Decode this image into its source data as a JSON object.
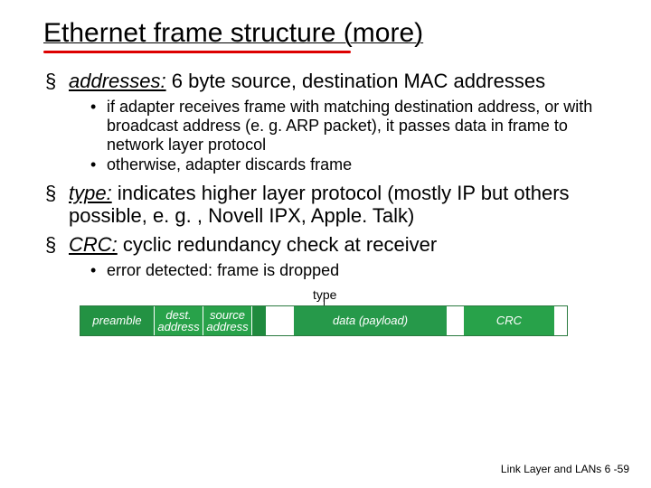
{
  "title": "Ethernet frame structure (more)",
  "bullets": {
    "b1_label": "addresses:",
    "b1_rest": " 6 byte source, destination MAC addresses",
    "b1_sub1": "if adapter receives frame with matching destination address, or with broadcast address (e. g. ARP packet), it passes data in frame to network layer protocol",
    "b1_sub2": "otherwise, adapter discards frame",
    "b2_label": "type:",
    "b2_rest": " indicates higher layer protocol (mostly IP but others possible, e. g. , Novell IPX, Apple. Talk)",
    "b3_label": "CRC:",
    "b3_rest": " cyclic redundancy check at receiver",
    "b3_sub1": "error detected: frame is dropped"
  },
  "diagram": {
    "type_label": "type",
    "preamble": "preamble",
    "dest": "dest. address",
    "source": "source address",
    "data": "data (payload)",
    "crc": "CRC"
  },
  "footer": "Link Layer and LANs  6 -59"
}
